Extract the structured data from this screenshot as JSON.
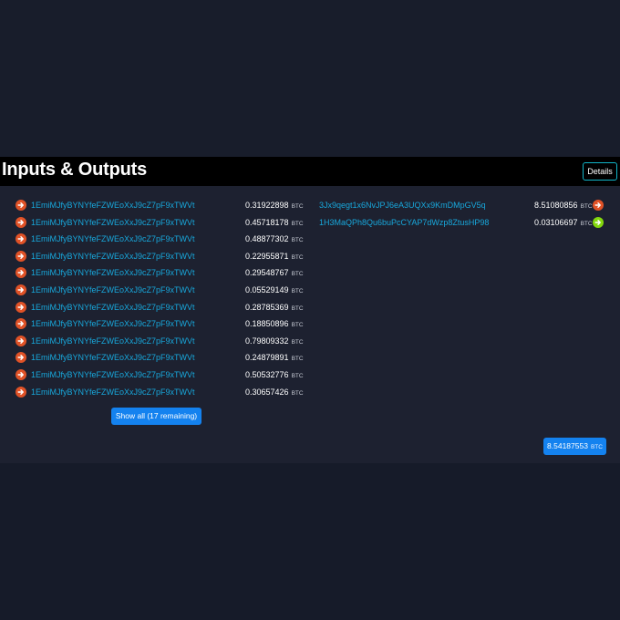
{
  "section": {
    "title": "Inputs & Outputs",
    "details_label": "Details"
  },
  "unit": "BTC",
  "inputs": [
    {
      "address": "1EmiMJfyBYNYfeFZWEoXxJ9cZ7pF9xTWVt",
      "amount": "0.31922898"
    },
    {
      "address": "1EmiMJfyBYNYfeFZWEoXxJ9cZ7pF9xTWVt",
      "amount": "0.45718178"
    },
    {
      "address": "1EmiMJfyBYNYfeFZWEoXxJ9cZ7pF9xTWVt",
      "amount": "0.48877302"
    },
    {
      "address": "1EmiMJfyBYNYfeFZWEoXxJ9cZ7pF9xTWVt",
      "amount": "0.22955871"
    },
    {
      "address": "1EmiMJfyBYNYfeFZWEoXxJ9cZ7pF9xTWVt",
      "amount": "0.29548767"
    },
    {
      "address": "1EmiMJfyBYNYfeFZWEoXxJ9cZ7pF9xTWVt",
      "amount": "0.05529149"
    },
    {
      "address": "1EmiMJfyBYNYfeFZWEoXxJ9cZ7pF9xTWVt",
      "amount": "0.28785369"
    },
    {
      "address": "1EmiMJfyBYNYfeFZWEoXxJ9cZ7pF9xTWVt",
      "amount": "0.18850896"
    },
    {
      "address": "1EmiMJfyBYNYfeFZWEoXxJ9cZ7pF9xTWVt",
      "amount": "0.79809332"
    },
    {
      "address": "1EmiMJfyBYNYfeFZWEoXxJ9cZ7pF9xTWVt",
      "amount": "0.24879891"
    },
    {
      "address": "1EmiMJfyBYNYfeFZWEoXxJ9cZ7pF9xTWVt",
      "amount": "0.50532776"
    },
    {
      "address": "1EmiMJfyBYNYfeFZWEoXxJ9cZ7pF9xTWVt",
      "amount": "0.30657426"
    }
  ],
  "outputs": [
    {
      "address": "3Jx9qegt1x6NvJPJ6eA3UQXx9KmDMpGV5q",
      "amount": "8.51080856",
      "status": "spent",
      "icon": "arrow-right-icon",
      "color": "#e05227"
    },
    {
      "address": "1H3MaQPh8Qu6buPcCYAP7dWzp8ZtusHP98",
      "amount": "0.03106697",
      "status": "unspent",
      "icon": "arrow-right-icon",
      "color": "#84d80d"
    }
  ],
  "show_all_label": "Show all (17 remaining)",
  "total": {
    "amount": "8.54187553",
    "unit": "BTC"
  },
  "colors": {
    "background": "#161b29",
    "panel": "#1d2130",
    "header": "#000000",
    "link": "#18a8dc",
    "accent": "#1482ef",
    "details_border": "#11b5c8",
    "spent": "#e05227",
    "unspent": "#84d80d"
  }
}
